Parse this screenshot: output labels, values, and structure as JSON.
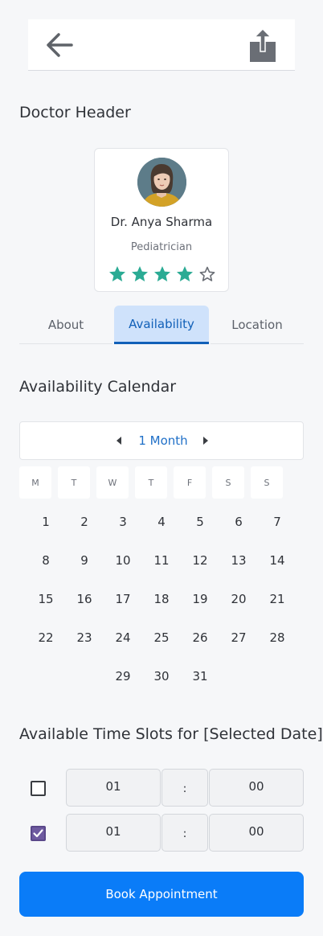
{
  "header": {
    "back_icon": "arrow-left-icon",
    "share_icon": "share-icon"
  },
  "doctor_section": {
    "title": "Doctor Header",
    "name": "Dr. Anya Sharma",
    "specialty": "Pediatrician",
    "rating": 4,
    "rating_max": 5,
    "star_color": "#2bab94"
  },
  "tabs": [
    {
      "label": "About",
      "active": false
    },
    {
      "label": "Availability",
      "active": true
    },
    {
      "label": "Location",
      "active": false
    }
  ],
  "calendar": {
    "title": "Availability Calendar",
    "range_label": "1 Month",
    "weekdays": [
      "M",
      "T",
      "W",
      "T",
      "F",
      "S",
      "S"
    ],
    "weeks": [
      [
        "1",
        "2",
        "3",
        "4",
        "5",
        "6",
        "7"
      ],
      [
        "8",
        "9",
        "10",
        "11",
        "12",
        "13",
        "14"
      ],
      [
        "15",
        "16",
        "17",
        "18",
        "19",
        "20",
        "21"
      ],
      [
        "22",
        "23",
        "24",
        "25",
        "26",
        "27",
        "28"
      ],
      [
        "",
        "",
        "29",
        "30",
        "31",
        "",
        ""
      ]
    ]
  },
  "time_slots": {
    "title": "Available Time Slots for [Selected Date]",
    "slots": [
      {
        "checked": false,
        "hour": "01",
        "separator": ":",
        "minute": "00"
      },
      {
        "checked": true,
        "hour": "01",
        "separator": ":",
        "minute": "00"
      }
    ]
  },
  "book_button": {
    "label": "Book Appointment",
    "color": "#0a7cf8"
  }
}
